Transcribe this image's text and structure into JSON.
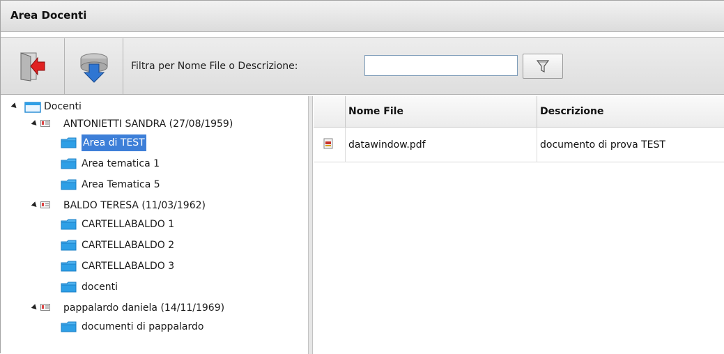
{
  "window": {
    "title": "Area Docenti"
  },
  "toolbar": {
    "exit_icon": "exit-door-icon",
    "download_icon": "download-disk-icon",
    "filter_label": "Filtra per Nome File o Descrizione:",
    "filter_value": "",
    "filter_placeholder": "",
    "filter_button_icon": "funnel-icon"
  },
  "tree": {
    "root": {
      "label": "Docenti"
    },
    "teachers": [
      {
        "label": "ANTONIETTI SANDRA (27/08/1959)",
        "folders": [
          {
            "label": "Area di TEST",
            "selected": true
          },
          {
            "label": "Area tematica 1"
          },
          {
            "label": "Area Tematica 5"
          }
        ]
      },
      {
        "label": "BALDO TERESA (11/03/1962)",
        "folders": [
          {
            "label": "CARTELLABALDO 1"
          },
          {
            "label": "CARTELLABALDO 2"
          },
          {
            "label": "CARTELLABALDO 3"
          },
          {
            "label": "docenti"
          }
        ]
      },
      {
        "label": "pappalardo daniela (14/11/1969)",
        "folders": [
          {
            "label": "documenti di pappalardo"
          }
        ]
      }
    ]
  },
  "grid": {
    "columns": [
      "Nome File",
      "Descrizione"
    ],
    "rows": [
      {
        "file": "datawindow.pdf",
        "description": "documento di prova TEST",
        "icon": "pdf-file-icon"
      }
    ]
  },
  "colors": {
    "selection": "#3d7fd8",
    "folder": "#2e9fe6"
  }
}
